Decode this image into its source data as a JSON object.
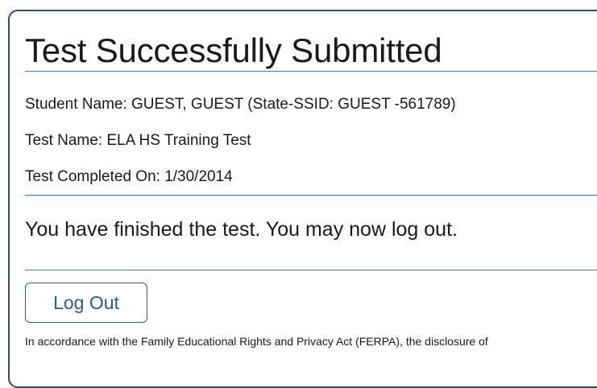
{
  "page": {
    "title": "Test Successfully Submitted",
    "student_name_line": "Student Name: GUEST, GUEST (State-SSID: GUEST -561789)",
    "test_name_line": "Test Name: ELA HS Training Test",
    "completed_on_line": "Test Completed On: 1/30/2014",
    "message": "You have finished the test. You may now log out.",
    "logout_label": "Log Out",
    "ferpa_notice": "In accordance with the Family Educational Rights and Privacy Act (FERPA), the disclosure of"
  },
  "colors": {
    "frame_border": "#2f4f6f",
    "rule": "#4a7a9b",
    "button_text": "#2f5b86"
  }
}
